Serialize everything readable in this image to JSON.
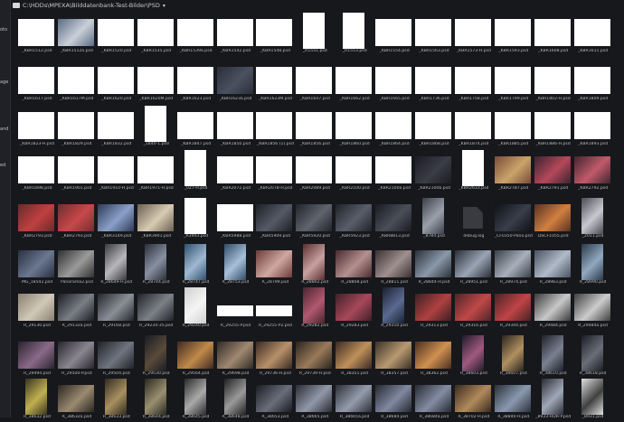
{
  "app": {
    "path": "C:\\HDDs\\MPEXA\\Bilddatenbank-Test-Bilder\\PSD",
    "side_labels": [
      "oto",
      "age",
      "and",
      "ed"
    ]
  },
  "colors": {
    "background": "#17181c",
    "panel": "#202126",
    "caption": "#b9b9b9",
    "thumb_white": "#ffffff"
  },
  "rows": [
    {
      "items": [
        {
          "label": "_KBR1512.psd",
          "kind": "white"
        },
        {
          "label": "_KBR1512a.psd",
          "kind": "photo",
          "tint": [
            "#5a6b84",
            "#c9d0d8"
          ]
        },
        {
          "label": "_KBR1520.psd",
          "kind": "white"
        },
        {
          "label": "_KBR1535.psd",
          "kind": "white"
        },
        {
          "label": "_KBR1539a.psd",
          "kind": "white"
        },
        {
          "label": "_KBR1542.psd",
          "kind": "white"
        },
        {
          "label": "_KBR1548.psd",
          "kind": "white"
        },
        {
          "label": "_R1551.psd",
          "kind": "white-tall"
        },
        {
          "label": "_R1553.psd",
          "kind": "white-tall"
        },
        {
          "label": "_KBR1554.psd",
          "kind": "white"
        },
        {
          "label": "_KBR1563.psd",
          "kind": "white"
        },
        {
          "label": "_KBR1573-H.psd",
          "kind": "white"
        },
        {
          "label": "_KBR1593.psd",
          "kind": "white"
        },
        {
          "label": "_KBR1608.psd",
          "kind": "white"
        },
        {
          "label": "_KBR1611.psd",
          "kind": "white"
        }
      ]
    },
    {
      "items": [
        {
          "label": "_KBR1617.psd",
          "kind": "white"
        },
        {
          "label": "_KBR1617M.psd",
          "kind": "white"
        },
        {
          "label": "_KBR1620.psd",
          "kind": "white"
        },
        {
          "label": "_KBR1620M.psd",
          "kind": "white"
        },
        {
          "label": "_KBR1623.psd",
          "kind": "white"
        },
        {
          "label": "_KBR1623a.psd",
          "kind": "photo",
          "tint": [
            "#2a2e38",
            "#4a5160"
          ]
        },
        {
          "label": "_KBR1623M.psd",
          "kind": "white"
        },
        {
          "label": "_KBR1647.psd",
          "kind": "white"
        },
        {
          "label": "_KBR1662.psd",
          "kind": "white"
        },
        {
          "label": "_KBR1665.psd",
          "kind": "white"
        },
        {
          "label": "_KBR1736.psd",
          "kind": "white"
        },
        {
          "label": "_KBR1758.psd",
          "kind": "white"
        },
        {
          "label": "_KBR1799.psd",
          "kind": "white"
        },
        {
          "label": "_KBR1802-H.psd",
          "kind": "white"
        },
        {
          "label": "_KBR1809.psd",
          "kind": "white"
        }
      ]
    },
    {
      "items": [
        {
          "label": "_KBR1823-H.psd",
          "kind": "white"
        },
        {
          "label": "_KBR1829.psd",
          "kind": "white"
        },
        {
          "label": "_KBR1832.psd",
          "kind": "white"
        },
        {
          "label": "_1840-1.psd",
          "kind": "white-tall"
        },
        {
          "label": "_KBR1847.psd",
          "kind": "white"
        },
        {
          "label": "_KBR1850.psd",
          "kind": "white"
        },
        {
          "label": "_KBR1856 (1).psd",
          "kind": "white"
        },
        {
          "label": "_KBR1856.psd",
          "kind": "white"
        },
        {
          "label": "_KBR1860.psd",
          "kind": "white"
        },
        {
          "label": "_KBR1864.psd",
          "kind": "white"
        },
        {
          "label": "_KBR1868.psd",
          "kind": "white"
        },
        {
          "label": "_KBR1874.psd",
          "kind": "white"
        },
        {
          "label": "_KBR1885.psd",
          "kind": "white"
        },
        {
          "label": "_KBR1886-H.psd",
          "kind": "white"
        },
        {
          "label": "_KBR1893.psd",
          "kind": "white"
        }
      ]
    },
    {
      "items": [
        {
          "label": "_KBR1898.psd",
          "kind": "white"
        },
        {
          "label": "_KBR1901.psd",
          "kind": "white"
        },
        {
          "label": "_KBR1910-H.psd",
          "kind": "white"
        },
        {
          "label": "_KBR1971-H.psd",
          "kind": "white"
        },
        {
          "label": "_027-H.psd",
          "kind": "white-tall"
        },
        {
          "label": "_KBR2072.psd",
          "kind": "white"
        },
        {
          "label": "_KBR2078-H.psd",
          "kind": "white"
        },
        {
          "label": "_KBR2089.psd",
          "kind": "white"
        },
        {
          "label": "_KBR2100.psd",
          "kind": "white"
        },
        {
          "label": "_KBR2100a.psd",
          "kind": "white"
        },
        {
          "label": "_KBR2100b.psd",
          "kind": "photo",
          "tint": [
            "#1c1c22",
            "#3a3c46"
          ]
        },
        {
          "label": "_KBR2633.psd",
          "kind": "white-tall"
        },
        {
          "label": "_KBR2787.psd",
          "kind": "photo",
          "tint": [
            "#7a4a3a",
            "#c9a46a"
          ]
        },
        {
          "label": "_KBR2791.psd",
          "kind": "photo",
          "tint": [
            "#3a2430",
            "#b4485a"
          ]
        },
        {
          "label": "_KBR2792.psd",
          "kind": "photo",
          "tint": [
            "#402630",
            "#c05a6a"
          ]
        }
      ]
    },
    {
      "items": [
        {
          "label": "_KBR2793.psd",
          "kind": "photo",
          "tint": [
            "#6a2a2a",
            "#c04040"
          ]
        },
        {
          "label": "_KBR2793.psd",
          "kind": "photo",
          "tint": [
            "#702e30",
            "#c8484a"
          ]
        },
        {
          "label": "_KBR3149.psd",
          "kind": "photo",
          "tint": [
            "#2e3a58",
            "#8aa0c8"
          ]
        },
        {
          "label": "_KBR3901.psd",
          "kind": "photo",
          "tint": [
            "#6a6052",
            "#d8cbb2"
          ]
        },
        {
          "label": "_R3943.psd",
          "kind": "white-tall"
        },
        {
          "label": "_KBR5988.psd",
          "kind": "white"
        },
        {
          "label": "_KBR5909.psd",
          "kind": "photo",
          "tint": [
            "#1e2026",
            "#565a66"
          ]
        },
        {
          "label": "_KBR5920.psd",
          "kind": "photo",
          "tint": [
            "#22242a",
            "#60646e"
          ]
        },
        {
          "label": "_KBR5923.psd",
          "kind": "photo",
          "tint": [
            "#202228",
            "#5a5e6a"
          ]
        },
        {
          "label": "_KBR8813.psd",
          "kind": "photo",
          "tint": [
            "#1a1c22",
            "#4a4e58"
          ]
        },
        {
          "label": "_8784.psd",
          "kind": "photo-tall",
          "tint": [
            "#3a3e48",
            "#9aa0aa"
          ]
        },
        {
          "label": "debug.log",
          "kind": "doc"
        },
        {
          "label": "_CF0350-Pano.psd",
          "kind": "photo",
          "tint": [
            "#101218",
            "#3a3e4a"
          ]
        },
        {
          "label": "DSCF1055.psd",
          "kind": "photo",
          "tint": [
            "#5a3020",
            "#d08040"
          ]
        },
        {
          "label": "_2011.psd",
          "kind": "photo-tall",
          "tint": [
            "#4a4a50",
            "#c8c8d0"
          ]
        }
      ]
    },
    {
      "items": [
        {
          "label": "MG_18542.psd",
          "kind": "photo",
          "tint": [
            "#2a3040",
            "#6a7890"
          ]
        },
        {
          "label": "Panorama2.psd",
          "kind": "photo",
          "tint": [
            "#303030",
            "#9a9a9a"
          ]
        },
        {
          "label": "R_28649-H.psd",
          "kind": "photo-tall",
          "tint": [
            "#3a3a3e",
            "#b8b8bc"
          ]
        },
        {
          "label": "R_28744.psd",
          "kind": "photo-tall",
          "tint": [
            "#2a2e3a",
            "#8890a0"
          ]
        },
        {
          "label": "R_28747.psd",
          "kind": "photo-tall",
          "tint": [
            "#2e5070",
            "#a0b8d0"
          ]
        },
        {
          "label": "R_28753.psd",
          "kind": "photo-tall",
          "tint": [
            "#304a68",
            "#a8c0d8"
          ]
        },
        {
          "label": "R_28799.psd",
          "kind": "photo",
          "tint": [
            "#6a3a3a",
            "#d0a8a0"
          ]
        },
        {
          "label": "R_28802.psd",
          "kind": "photo-tall",
          "tint": [
            "#5a2e30",
            "#c8a0a0"
          ]
        },
        {
          "label": "R_28808.psd",
          "kind": "photo",
          "tint": [
            "#4a2a2e",
            "#b49090"
          ]
        },
        {
          "label": "R_28811.psd",
          "kind": "photo",
          "tint": [
            "#3a3030",
            "#a09090"
          ]
        },
        {
          "label": "R_28844-H.psd",
          "kind": "photo",
          "tint": [
            "#2a3038",
            "#8a98a8"
          ]
        },
        {
          "label": "R_28951.psd",
          "kind": "photo",
          "tint": [
            "#2a2e38",
            "#9aa4b4"
          ]
        },
        {
          "label": "R_28974.psd",
          "kind": "photo",
          "tint": [
            "#3a4048",
            "#a8b0bc"
          ]
        },
        {
          "label": "R_28983.psd",
          "kind": "photo",
          "tint": [
            "#4a5260",
            "#b0bac8"
          ]
        },
        {
          "label": "R_28990.psd",
          "kind": "photo-tall",
          "tint": [
            "#2a3a48",
            "#90a8c0"
          ]
        }
      ]
    },
    {
      "items": [
        {
          "label": "R_29130.psd",
          "kind": "photo",
          "tint": [
            "#8a8070",
            "#d0c8b8"
          ]
        },
        {
          "label": "R_29132a.psd",
          "kind": "photo",
          "tint": [
            "#1a1c20",
            "#7a7e86"
          ]
        },
        {
          "label": "R_29168.psd",
          "kind": "photo",
          "tint": [
            "#24262c",
            "#8a8e96"
          ]
        },
        {
          "label": "R_29234-35.psd",
          "kind": "photo",
          "tint": [
            "#202228",
            "#7c8088"
          ]
        },
        {
          "label": "R_29240.psd",
          "kind": "photo-tall",
          "tint": [
            "#d0d0d0",
            "#f4f4f4"
          ]
        },
        {
          "label": "R_29255-P.psd",
          "kind": "white-short"
        },
        {
          "label": "R_29255-P2.psd",
          "kind": "white-short"
        },
        {
          "label": "R_29282.psd",
          "kind": "photo-tall",
          "tint": [
            "#4a2430",
            "#b05870"
          ]
        },
        {
          "label": "R_29283.psd",
          "kind": "photo",
          "tint": [
            "#402028",
            "#a8485a"
          ]
        },
        {
          "label": "R_29310.psd",
          "kind": "photo-tall",
          "tint": [
            "#1a2030",
            "#5a6a90"
          ]
        },
        {
          "label": "R_29313.psd",
          "kind": "photo",
          "tint": [
            "#3a2024",
            "#b04040"
          ]
        },
        {
          "label": "R_29316.psd",
          "kind": "photo",
          "tint": [
            "#502428",
            "#c04848"
          ]
        },
        {
          "label": "R_29344.psd",
          "kind": "photo",
          "tint": [
            "#4a2226",
            "#c04446"
          ]
        },
        {
          "label": "R_29484.psd",
          "kind": "photo",
          "tint": [
            "#3a3a3a",
            "#c8c8c8"
          ]
        },
        {
          "label": "R_29484a.psd",
          "kind": "photo",
          "tint": [
            "#3e3e3e",
            "#cccccc"
          ]
        }
      ]
    },
    {
      "items": [
        {
          "label": "R_29494.psd",
          "kind": "photo",
          "tint": [
            "#2a2430",
            "#8a6a88"
          ]
        },
        {
          "label": "R_29500-P.psd",
          "kind": "photo",
          "tint": [
            "#28262c",
            "#8a8690"
          ]
        },
        {
          "label": "R_29504.psd",
          "kind": "photo",
          "tint": [
            "#202226",
            "#707480"
          ]
        },
        {
          "label": "R_29530.psd",
          "kind": "photo-tall",
          "tint": [
            "#1a1c24",
            "#5a4a3a"
          ]
        },
        {
          "label": "R_29564.psd",
          "kind": "photo",
          "tint": [
            "#402a20",
            "#c08a4a"
          ]
        },
        {
          "label": "R_29698.psd",
          "kind": "photo",
          "tint": [
            "#302a26",
            "#a08870"
          ]
        },
        {
          "label": "R_29736-H.psd",
          "kind": "photo",
          "tint": [
            "#3a2a22",
            "#b8906a"
          ]
        },
        {
          "label": "R_29739-H.psd",
          "kind": "photo",
          "tint": [
            "#2a2420",
            "#9a7a5a"
          ]
        },
        {
          "label": "R_38351.psd",
          "kind": "photo",
          "tint": [
            "#3a2a24",
            "#c0905a"
          ]
        },
        {
          "label": "R_38357.psd",
          "kind": "photo",
          "tint": [
            "#3a3028",
            "#b89a70"
          ]
        },
        {
          "label": "R_38362.psd",
          "kind": "photo",
          "tint": [
            "#4a3020",
            "#d09050"
          ]
        },
        {
          "label": "R_38603.psd",
          "kind": "photo-tall",
          "tint": [
            "#201a2a",
            "#a05a80"
          ]
        },
        {
          "label": "R_38607.psd",
          "kind": "photo-tall",
          "tint": [
            "#2a241e",
            "#b09060"
          ]
        },
        {
          "label": "R_38610.psd",
          "kind": "photo-tall",
          "tint": [
            "#1e2028",
            "#7a8090"
          ]
        },
        {
          "label": "R_38618.psd",
          "kind": "photo-tall",
          "tint": [
            "#1a1c22",
            "#6a6e78"
          ]
        }
      ]
    },
    {
      "items": [
        {
          "label": "R_38632.psd",
          "kind": "photo-tall",
          "tint": [
            "#3a3420",
            "#c0b050"
          ]
        },
        {
          "label": "R_38632a.psd",
          "kind": "photo",
          "tint": [
            "#2a2620",
            "#9a8a70"
          ]
        },
        {
          "label": "R_38633.psd",
          "kind": "photo-tall",
          "tint": [
            "#302a20",
            "#a89060"
          ]
        },
        {
          "label": "R_38644.psd",
          "kind": "photo-tall",
          "tint": [
            "#2a2820",
            "#9a9070"
          ]
        },
        {
          "label": "R_38645.psd",
          "kind": "photo-tall",
          "tint": [
            "#2a2a2a",
            "#aaaaaa"
          ]
        },
        {
          "label": "R_38648.psd",
          "kind": "photo-tall",
          "tint": [
            "#202020",
            "#9a9a9a"
          ]
        },
        {
          "label": "R_38653.psd",
          "kind": "photo",
          "tint": [
            "#1a1c22",
            "#6a6e7a"
          ]
        },
        {
          "label": "R_38665.psd",
          "kind": "photo",
          "tint": [
            "#2a2c34",
            "#9098a8"
          ]
        },
        {
          "label": "R_38665a.psd",
          "kind": "photo",
          "tint": [
            "#2c2e36",
            "#949cac"
          ]
        },
        {
          "label": "R_38684.psd",
          "kind": "photo",
          "tint": [
            "#242830",
            "#8088a0"
          ]
        },
        {
          "label": "R_38684a.psd",
          "kind": "photo",
          "tint": [
            "#262a32",
            "#848ca4"
          ]
        },
        {
          "label": "R_38702-H.psd",
          "kind": "photo",
          "tint": [
            "#3a2a20",
            "#b08a5a"
          ]
        },
        {
          "label": "R_38840-H.psd",
          "kind": "photo",
          "tint": [
            "#2a3038",
            "#8a98b0"
          ]
        },
        {
          "label": "_8933-HDR-P.psd",
          "kind": "photo-tall",
          "tint": [
            "#2a2c34",
            "#a0a8b8"
          ]
        },
        {
          "label": "_8931.psd",
          "kind": "photo-tall",
          "tint": [
            "#e0e0e0",
            "#404040"
          ]
        }
      ]
    }
  ]
}
